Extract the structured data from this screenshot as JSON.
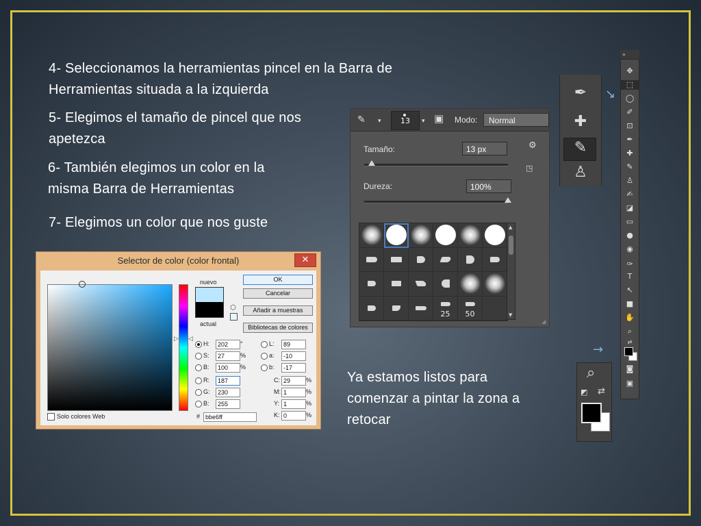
{
  "slide": {
    "border_color": "#d4c441",
    "steps": [
      [
        "4- Seleccionamos la herramientas pincel en la Barra de",
        "Herramientas situada a la izquierda"
      ],
      [
        "5- Elegimos el tamaño de pincel que nos",
        "apetezca"
      ],
      [
        "6- También elegimos un color en la",
        "misma Barra de Herramientas"
      ],
      [
        "7- Elegimos un color que nos guste"
      ]
    ],
    "closing": [
      "Ya estamos listos para",
      "comenzar a pintar la zona a",
      "retocar"
    ]
  },
  "color_dialog": {
    "title": "Selector de color (color frontal)",
    "close_label": "✕",
    "new_label": "nuevo",
    "current_label": "actual",
    "new_color": "#bbe6ff",
    "current_color": "#000000",
    "buttons": {
      "ok": "OK",
      "cancel": "Cancelar",
      "add_swatches": "Añadir a muestras",
      "libraries": "Bibliotecas de colores"
    },
    "hsb": [
      {
        "label": "H:",
        "value": "202",
        "unit": "°"
      },
      {
        "label": "S:",
        "value": "27",
        "unit": "%"
      },
      {
        "label": "B:",
        "value": "100",
        "unit": "%"
      }
    ],
    "rgb": [
      {
        "label": "R:",
        "value": "187"
      },
      {
        "label": "G:",
        "value": "230"
      },
      {
        "label": "B:",
        "value": "255"
      }
    ],
    "lab": [
      {
        "label": "L:",
        "value": "89"
      },
      {
        "label": "a:",
        "value": "-10"
      },
      {
        "label": "b:",
        "value": "-17"
      }
    ],
    "cmyk": [
      {
        "label": "C:",
        "value": "29",
        "unit": "%"
      },
      {
        "label": "M:",
        "value": "1",
        "unit": "%"
      },
      {
        "label": "Y:",
        "value": "1",
        "unit": "%"
      },
      {
        "label": "K:",
        "value": "0",
        "unit": "%"
      }
    ],
    "hex_label": "#",
    "hex_value": "bbe6ff",
    "web_only_label": "Solo colores Web"
  },
  "brush_panel": {
    "size_badge": "13",
    "mode_label": "Modo:",
    "mode_value": "Normal",
    "size_label": "Tamaño:",
    "size_value": "13 px",
    "size_fraction": 0.05,
    "hardness_label": "Dureza:",
    "hardness_value": "100%",
    "hardness_fraction": 1.0,
    "tip_numbers": [
      "25",
      "50"
    ]
  }
}
